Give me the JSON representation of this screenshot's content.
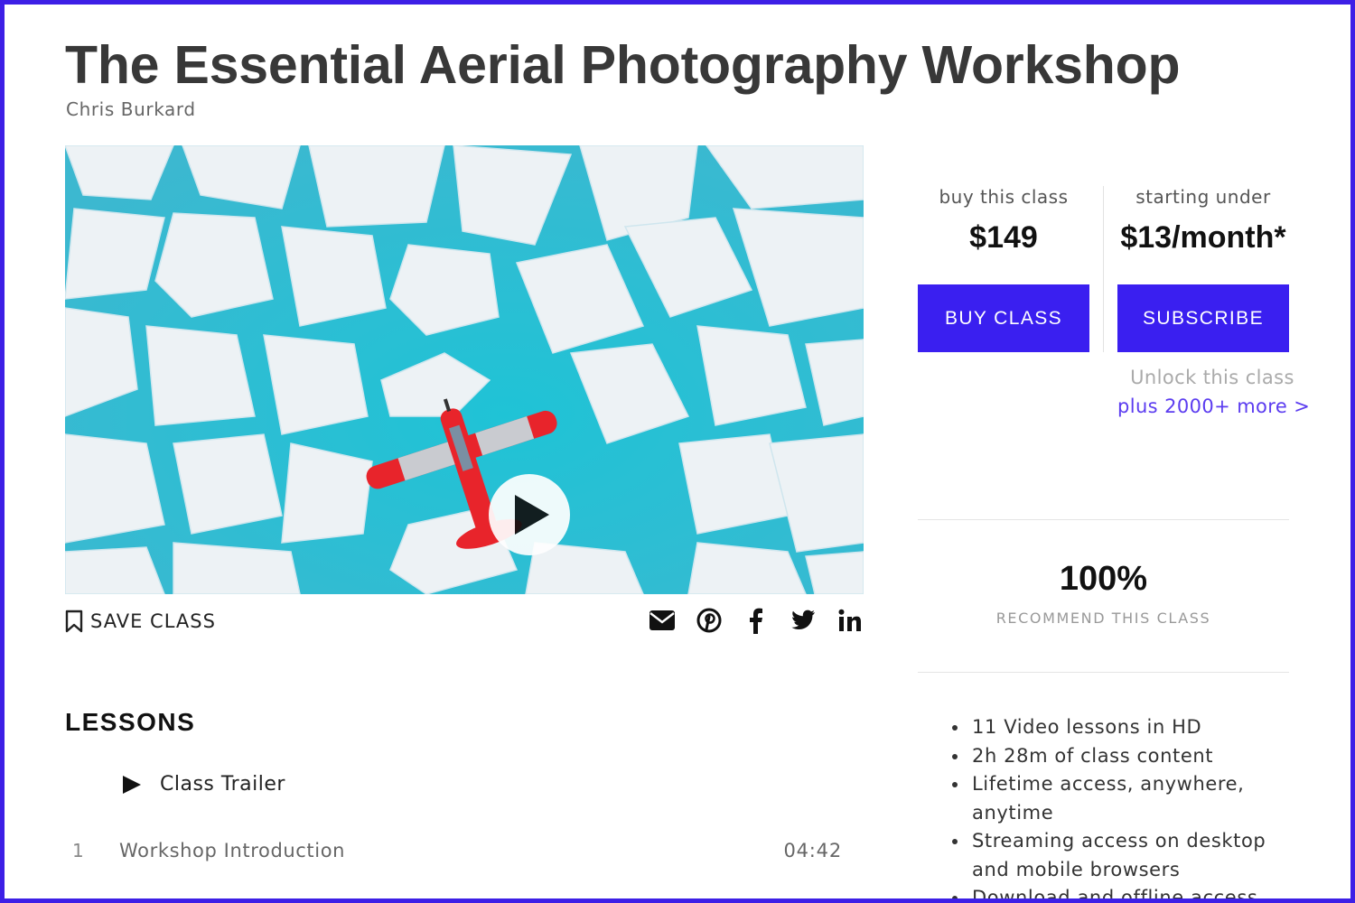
{
  "course": {
    "title": "The Essential Aerial Photography Workshop",
    "author": "Chris Burkard"
  },
  "video": {
    "play_icon": "play-icon"
  },
  "actions": {
    "save_label": "SAVE CLASS",
    "share_icons": [
      "email-icon",
      "pinterest-icon",
      "facebook-icon",
      "twitter-icon",
      "linkedin-icon"
    ]
  },
  "lessons": {
    "heading": "LESSONS",
    "trailer_label": "Class Trailer",
    "items": [
      {
        "number": "1",
        "title": "Workshop Introduction",
        "duration": "04:42"
      }
    ]
  },
  "purchase": {
    "buy_label": "buy this class",
    "buy_price": "$149",
    "buy_button": "BUY CLASS",
    "subscribe_label": "starting under",
    "subscribe_price": "$13/month*",
    "subscribe_button": "SUBSCRIBE",
    "unlock_text": "Unlock this class",
    "unlock_link": "plus 2000+ more >"
  },
  "rating": {
    "percent": "100%",
    "label": "RECOMMEND THIS CLASS"
  },
  "features": [
    "11 Video lessons in HD",
    "2h 28m of class content",
    "Lifetime access, anywhere, anytime",
    "Streaming access on desktop and mobile browsers",
    "Download and offline access"
  ],
  "colors": {
    "accent": "#3a1ff0",
    "link": "#5b3cf0",
    "frame": "#3d1fe6",
    "water": "#2bbcd4",
    "ice": "#eef3f6",
    "plane": "#e8242b"
  }
}
